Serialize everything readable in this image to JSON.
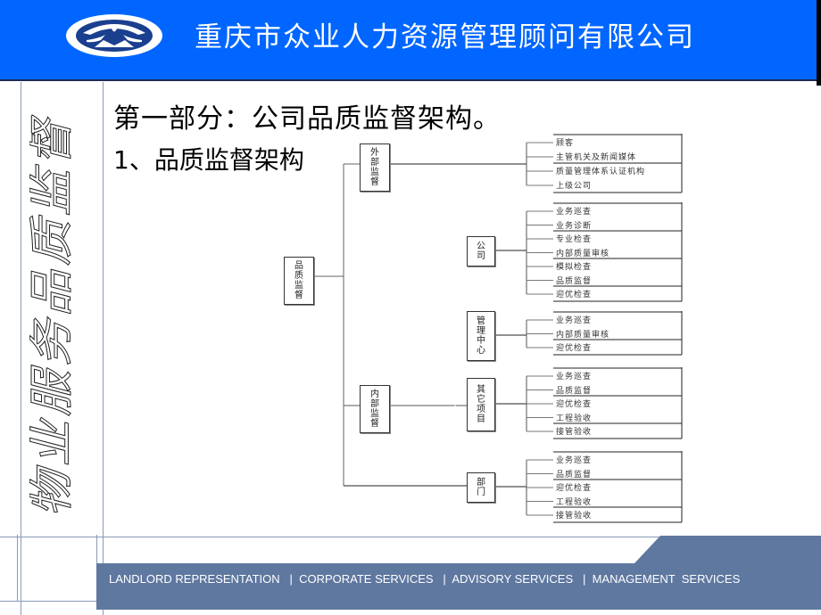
{
  "header": {
    "logo_icon": "company-logo-icon",
    "company_name": "重庆市众业人力资源管理顾问有限公司",
    "brand_color": "#0066ff"
  },
  "sidebar": {
    "vertical_title": "物业服务品质监督"
  },
  "main": {
    "section_title": "第一部分：公司品质监督架构。",
    "sub_title": "1、品质监督架构"
  },
  "diagram": {
    "root": {
      "label": "品质监督",
      "chars": [
        "品",
        "质",
        "监",
        "督"
      ]
    },
    "external": {
      "label": "外部监督",
      "chars": [
        "外",
        "部",
        "监",
        "督"
      ],
      "items": [
        "顾客",
        "主管机关及新闻媒体",
        "质量管理体系认证机构",
        "上级公司"
      ]
    },
    "internal": {
      "label": "内部监督",
      "chars": [
        "内",
        "部",
        "监",
        "督"
      ],
      "groups": [
        {
          "label": "公司",
          "chars": [
            "公",
            "司"
          ],
          "items": [
            "业务巡查",
            "业务诊断",
            "专业检查",
            "内部质量审核",
            "模拟检查",
            "品质监督",
            "迎优检查"
          ]
        },
        {
          "label": "管理中心",
          "chars": [
            "管",
            "理",
            "中",
            "心"
          ],
          "items": [
            "业务巡查",
            "内部质量审核",
            "迎优检查"
          ]
        },
        {
          "label": "其它项目",
          "chars": [
            "其",
            "它",
            "项",
            "目"
          ],
          "items": [
            "业务巡查",
            "品质监督",
            "迎优检查",
            "工程验收",
            "接管验收"
          ]
        },
        {
          "label": "部门",
          "chars": [
            "部",
            "门"
          ],
          "items": [
            "业务巡查",
            "品质监督",
            "迎优检查",
            "工程验收",
            "接管验收"
          ]
        }
      ]
    }
  },
  "footer": {
    "text": "LANDLORD REPRESENTATION   |  CORPORATE SERVICES   |  ADVISORY SERVICES   |  MANAGEMENT  SERVICES",
    "bar_color": "#5f78a0"
  }
}
